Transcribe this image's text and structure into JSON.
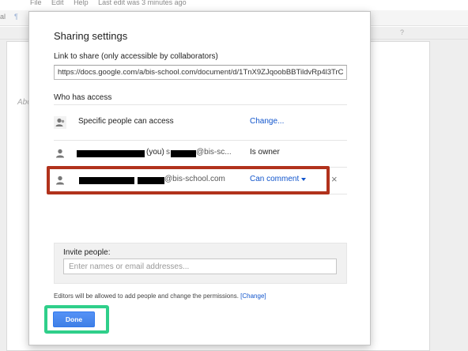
{
  "background": {
    "menubar": [
      "File",
      "Edit",
      "Help",
      "Last edit was 3 minutes ago"
    ],
    "toolbar_label": "al",
    "toolbar_glyph": "¶",
    "ruler_glyph": "?",
    "page_text": "Abo"
  },
  "dialog": {
    "title": "Sharing settings",
    "link_label": "Link to share (only accessible by collaborators)",
    "link_value": "https://docs.google.com/a/bis-school.com/document/d/1TnX9ZJqoobBBTildvRp4l3TrC",
    "access_label": "Who has access",
    "rows": [
      {
        "name": "Specific people can access",
        "action": "Change...",
        "icon": "people-icon"
      },
      {
        "suffix": "(you)",
        "email_prefix": "s",
        "email_domain": "@bis-sc...",
        "role": "Is owner",
        "icon": "person-icon"
      },
      {
        "email_domain": "@bis-school.com",
        "role": "Can comment",
        "remove": "×",
        "icon": "person-icon"
      }
    ],
    "invite": {
      "label": "Invite people:",
      "placeholder": "Enter names or email addresses..."
    },
    "note_text": "Editors will be allowed to add people and change the permissions.",
    "note_link": "[Change]",
    "done_label": "Done"
  },
  "annotations": {
    "red_box_color": "#b1321c",
    "green_box_color": "#2fcf8a"
  }
}
